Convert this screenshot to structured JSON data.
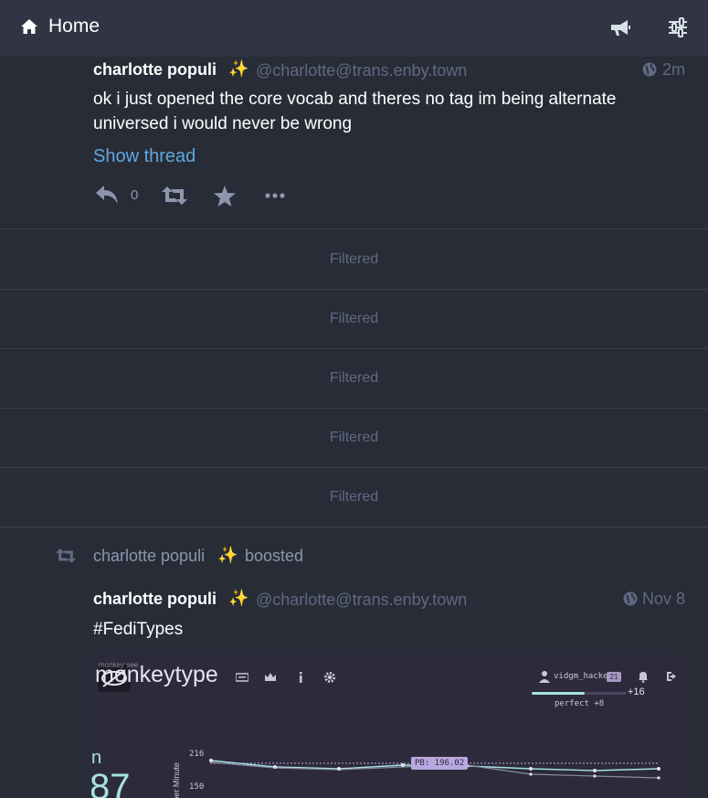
{
  "header": {
    "title": "Home",
    "icons": [
      "home-icon",
      "announcements-icon",
      "column-settings-icon"
    ]
  },
  "status1": {
    "display_name": "charlotte populi",
    "emoji": "✨",
    "acct": "@charlotte@trans.enby.town",
    "visibility_icon": "globe-icon",
    "timestamp": "2m",
    "content": "ok i just opened the core vocab and theres no tag im being alternate universed i would never be wrong",
    "show_thread": "Show thread",
    "reply_count": "0",
    "action_icons": [
      "reply-icon",
      "boost-icon",
      "favourite-icon",
      "more-icon"
    ]
  },
  "filtered": [
    "Filtered",
    "Filtered",
    "Filtered",
    "Filtered",
    "Filtered"
  ],
  "boost": {
    "booster_name": "charlotte populi",
    "emoji": "✨",
    "label": "boosted"
  },
  "status2": {
    "display_name": "charlotte populi",
    "emoji": "✨",
    "acct": "@charlotte@trans.enby.town",
    "timestamp": "Nov 8",
    "content": "#FediTypes"
  },
  "media": {
    "logo_small": "monkey see",
    "logo": "monkeytype",
    "username": "vidgm_hacker",
    "level": "21",
    "xp_gain": "+16",
    "perfect": "perfect +8",
    "wpm_label": "n",
    "wpm_value": "87",
    "axis_label": "Words per Minute",
    "ticks": [
      "216",
      "150"
    ],
    "pb_label": "PB: 196.02",
    "colors": {
      "accent": "#a6e3e0",
      "background": "#2d2b3b",
      "pb": "#b9a7e0"
    }
  }
}
